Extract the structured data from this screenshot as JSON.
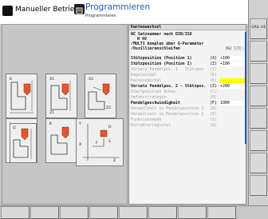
{
  "header": {
    "mode_label": "Manueller Betrieb",
    "program_title": "Programmieren",
    "program_subtitle": "Programmieren"
  },
  "right_softkeys": [
    "GRIL HE"
  ],
  "program": {
    "title": "Kantenwechsel",
    "lines": [
      {
        "text": "NC Satznummer nach DIN/ISO"
      },
      {
        "text": "N 40"
      },
      {
        "text": "/MULTI kompleo über G-Parameter"
      },
      {
        "text": "/Oszillierenschleifen",
        "code": "(G)",
        "value": "170"
      },
      {
        "text": "Stützposition (Position 1)",
        "code": "(X)",
        "value": "+100"
      },
      {
        "text": "Stützposition (Position 2)",
        "code": "(Z)",
        "value": "+100"
      },
      {
        "text": "Versatz Pendelpos. 1 - Stützpos",
        "code": "(I)"
      },
      {
        "text": "Kegelwinkel",
        "code": "(K)"
      },
      {
        "text": "Kantenumschal",
        "code": "(K)"
      },
      {
        "text": "Versatz Pendelpos. 2 - Stützpos.",
        "code": "(Z)",
        "value": "+200"
      },
      {
        "text": "Startposition Achse",
        "code": "(C)"
      },
      {
        "text": "Umfahrstrategie",
        "code": "(B)"
      },
      {
        "text": "Pendelgeschwindigkeit",
        "code": "(F)",
        "value": "1000"
      },
      {
        "text": "Verweilzeit in Pendelposition 1",
        "code": "(D)"
      },
      {
        "text": "Verweilzeit in Pendelposition 2",
        "code": "(E)"
      },
      {
        "text": "Funktionsmode",
        "code": "(S)"
      },
      {
        "text": "Korrekturregister",
        "code": "(Q)"
      }
    ]
  },
  "diagram_labels": [
    "K",
    "X1",
    "X2",
    "Z1",
    "Z2",
    "I",
    "K",
    "Q",
    "Z",
    "Y",
    "X",
    "F",
    "D",
    "S"
  ],
  "colors": {
    "accent": "#1f56c6",
    "highlight": "#ffff00",
    "workpiece": "#e8552a"
  }
}
